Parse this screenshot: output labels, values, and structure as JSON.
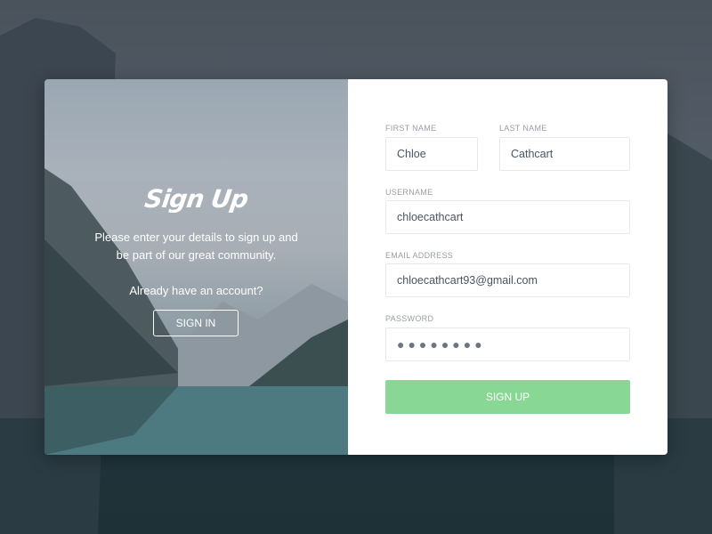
{
  "left": {
    "title": "Sign Up",
    "description": "Please enter your details to sign up and be part of our great community.",
    "already": "Already have an account?",
    "sign_in": "SIGN IN"
  },
  "form": {
    "first_name": {
      "label": "FIRST NAME",
      "value": "Chloe"
    },
    "last_name": {
      "label": "LAST NAME",
      "value": "Cathcart"
    },
    "username": {
      "label": "USERNAME",
      "value": "chloecathcart"
    },
    "email": {
      "label": "EMAIL ADDRESS",
      "value": "chloecathcart93@gmail.com"
    },
    "password": {
      "label": "PASSWORD",
      "value": "●●●●●●●●"
    },
    "submit": "SIGN UP"
  },
  "colors": {
    "accent": "#88d794"
  }
}
